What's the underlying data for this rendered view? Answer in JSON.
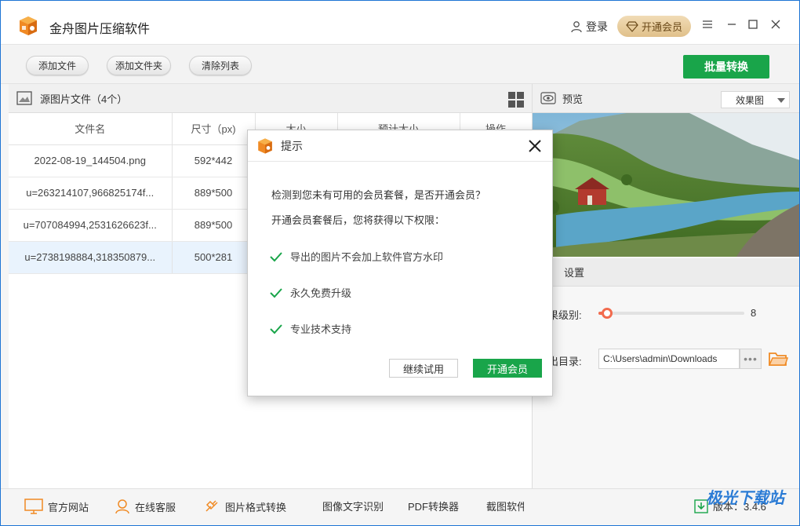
{
  "app": {
    "title": "金舟图片压缩软件"
  },
  "header": {
    "login_label": "登录",
    "vip_label": "开通会员"
  },
  "toolbar": {
    "add_file": "添加文件",
    "add_folder": "添加文件夹",
    "clear_list": "清除列表",
    "batch_convert": "批量转换"
  },
  "source_panel": {
    "title": "源图片文件（4个）",
    "columns": [
      "文件名",
      "尺寸（px)",
      "大小",
      "预计大小",
      "操作"
    ],
    "rows": [
      {
        "name": "2022-08-19_144504.png",
        "size": "592*442"
      },
      {
        "name": "u=263214107,966825174f...",
        "size": "889*500"
      },
      {
        "name": "u=707084994,2531626623f...",
        "size": "889*500"
      },
      {
        "name": "u=2738198884,318350879...",
        "size": "500*281"
      }
    ]
  },
  "preview": {
    "title": "预览",
    "effect_option": "效果图"
  },
  "settings": {
    "title": "设置",
    "level_label": "果级别:",
    "level_value": "8",
    "level_fraction": 0.06,
    "output_label": "出目录:",
    "output_path": "C:\\Users\\admin\\Downloads"
  },
  "bottom": {
    "links": [
      "官方网站",
      "在线客服",
      "图片格式转换",
      "图像文字识别",
      "PDF转换器",
      "截图软件"
    ],
    "version": "版本：3.4.6"
  },
  "dialog": {
    "title": "提示",
    "question": "检测到您未有可用的会员套餐，是否开通会员？",
    "intro": "开通会员套餐后，您将获得以下权限：",
    "benefits": [
      "导出的图片不会加上软件官方水印",
      "永久免费升级",
      "专业技术支持"
    ],
    "trial_button": "继续试用",
    "open_button": "开通会员"
  },
  "watermark": "极光下载站",
  "colors": {
    "accent_green": "#19a54a",
    "brand_orange": "#f08a24",
    "slider": "#f26b4e"
  }
}
